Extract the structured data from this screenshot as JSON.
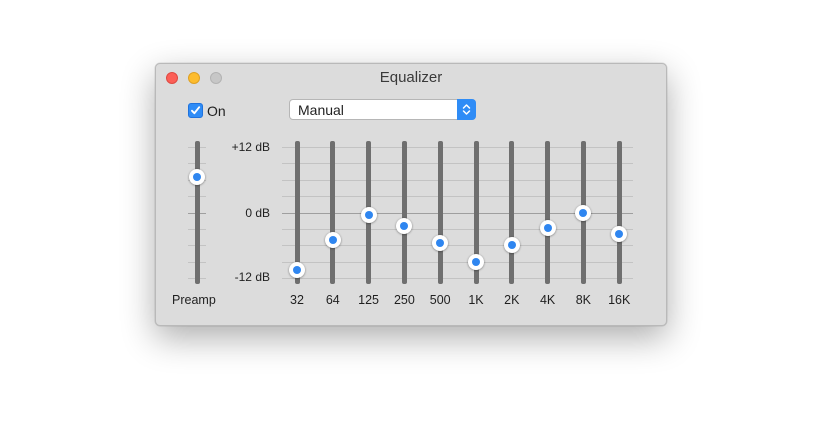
{
  "window": {
    "title": "Equalizer"
  },
  "controls": {
    "on_label": "On",
    "on_checked": true,
    "preset_selected": "Manual"
  },
  "scale": {
    "max_label": "+12 dB",
    "zero_label": "0 dB",
    "min_label": "-12 dB",
    "max_db": 12,
    "min_db": -12
  },
  "preamp": {
    "label": "Preamp",
    "value_db": 6.5
  },
  "bands": [
    {
      "label": "32",
      "gain_db": -10.5
    },
    {
      "label": "64",
      "gain_db": -5.0
    },
    {
      "label": "125",
      "gain_db": -0.5
    },
    {
      "label": "250",
      "gain_db": -2.5
    },
    {
      "label": "500",
      "gain_db": -5.5
    },
    {
      "label": "1K",
      "gain_db": -9.0
    },
    {
      "label": "2K",
      "gain_db": -6.0
    },
    {
      "label": "4K",
      "gain_db": -2.8
    },
    {
      "label": "8K",
      "gain_db": 0.0
    },
    {
      "label": "16K",
      "gain_db": -4.0
    }
  ],
  "colors": {
    "accent": "#2f8cf6",
    "close": "#fc5f57",
    "minimize": "#fdbc2e",
    "zoom_disabled": "#c7c7c7"
  }
}
